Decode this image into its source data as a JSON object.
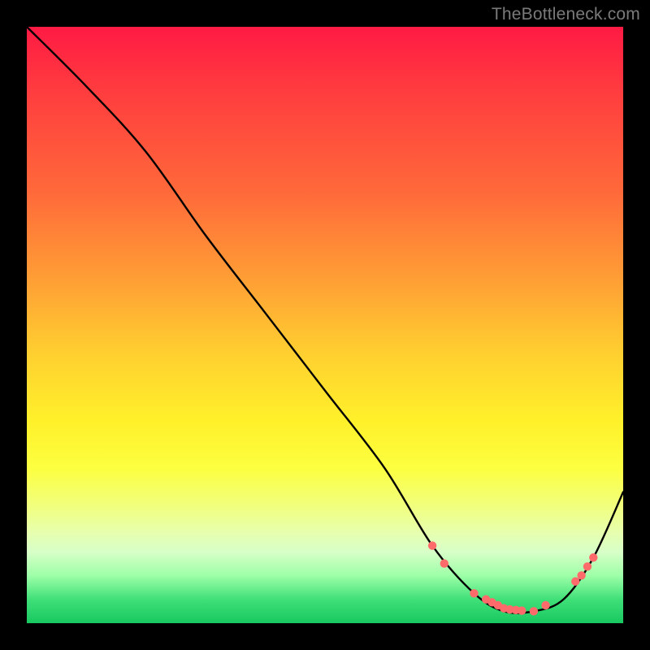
{
  "watermark": "TheBottleneck.com",
  "chart_data": {
    "type": "line",
    "title": "",
    "xlabel": "",
    "ylabel": "",
    "xlim": [
      0,
      100
    ],
    "ylim": [
      0,
      100
    ],
    "series": [
      {
        "name": "curve",
        "x": [
          0,
          10,
          20,
          30,
          40,
          50,
          60,
          68,
          75,
          80,
          85,
          90,
          95,
          100
        ],
        "y": [
          100,
          90,
          79,
          65,
          52,
          39,
          26,
          13,
          5,
          2,
          2,
          4,
          11,
          22
        ]
      }
    ],
    "markers": {
      "name": "highlight-dots",
      "color": "#ff6b6b",
      "x": [
        68,
        70,
        75,
        77,
        78,
        79,
        80,
        81,
        82,
        83,
        85,
        87,
        92,
        93,
        94,
        95
      ],
      "y": [
        13,
        10,
        5,
        4,
        3.5,
        3,
        2.5,
        2.3,
        2.2,
        2.1,
        2,
        3,
        7,
        8,
        9.5,
        11
      ]
    }
  }
}
